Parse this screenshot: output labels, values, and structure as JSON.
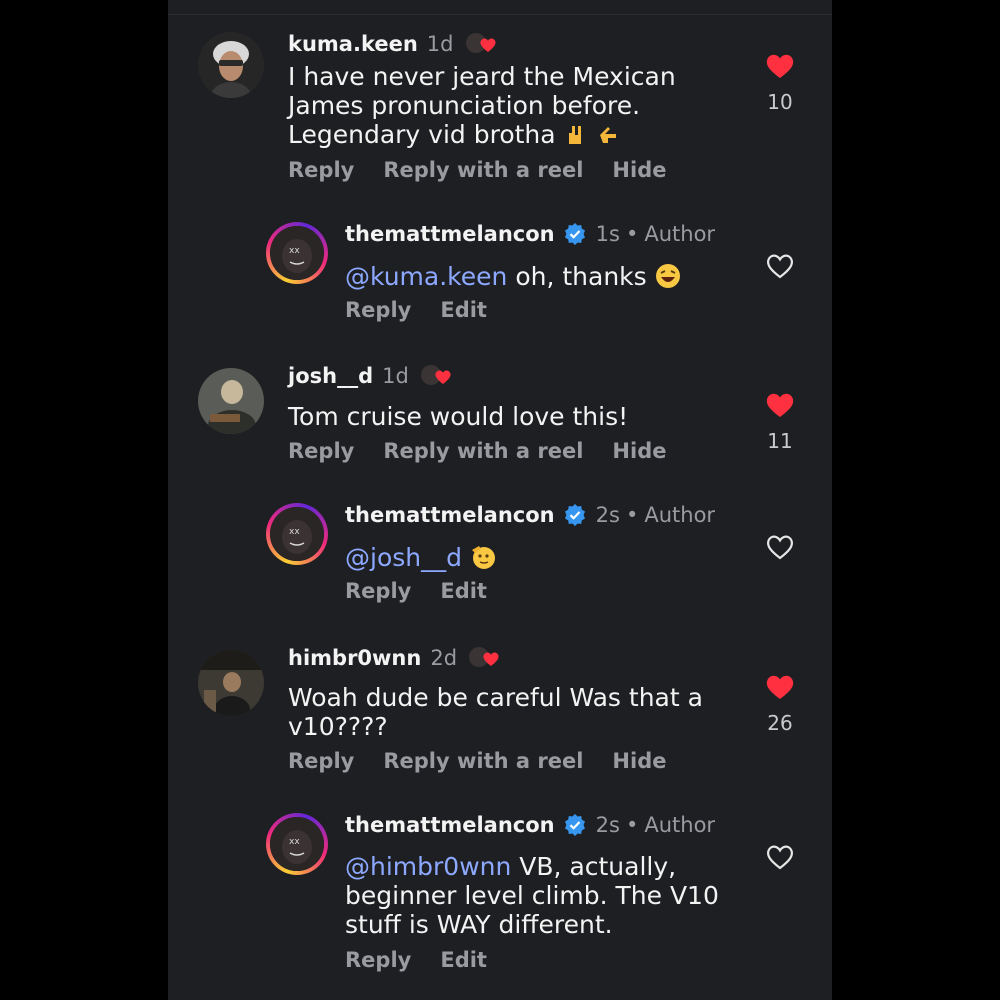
{
  "comments": [
    {
      "username": "kuma.keen",
      "time": "1d",
      "text_lines": [
        "I have never jeard the Mexican",
        "James pronunciation before.",
        "Legendary vid brotha"
      ],
      "emoji": [
        "rock-on-hand-icon",
        "pointing-hand-icon"
      ],
      "actions": [
        "Reply",
        "Reply with a reel",
        "Hide"
      ],
      "likes": "10",
      "liked": true
    },
    {
      "username": "themattmelancon",
      "time": "1s",
      "author_label": "Author",
      "mention": "@kuma.keen",
      "text": "oh, thanks",
      "emoji": [
        "laughing-face-icon"
      ],
      "actions": [
        "Reply",
        "Edit"
      ]
    },
    {
      "username": "josh__d",
      "time": "1d",
      "text": "Tom cruise would love this!",
      "actions": [
        "Reply",
        "Reply with a reel",
        "Hide"
      ],
      "likes": "11",
      "liked": true
    },
    {
      "username": "themattmelancon",
      "time": "2s",
      "author_label": "Author",
      "mention": "@josh__d",
      "emoji": [
        "saluting-face-icon"
      ],
      "actions": [
        "Reply",
        "Edit"
      ]
    },
    {
      "username": "himbr0wnn",
      "time": "2d",
      "text_lines": [
        "Woah dude be careful Was that a",
        "v10????"
      ],
      "actions": [
        "Reply",
        "Reply with a reel",
        "Hide"
      ],
      "likes": "26",
      "liked": true
    },
    {
      "username": "themattmelancon",
      "time": "2s",
      "author_label": "Author",
      "mention": "@himbr0wnn",
      "text_lines": [
        "VB, actually,",
        "beginner level climb. The V10",
        "stuff is WAY different."
      ],
      "actions": [
        "Reply",
        "Edit"
      ]
    }
  ],
  "colors": {
    "background": "#1e1f22",
    "like_red": "#ff3040",
    "mention": "#8ca8ff",
    "verified": "#3797f0"
  }
}
